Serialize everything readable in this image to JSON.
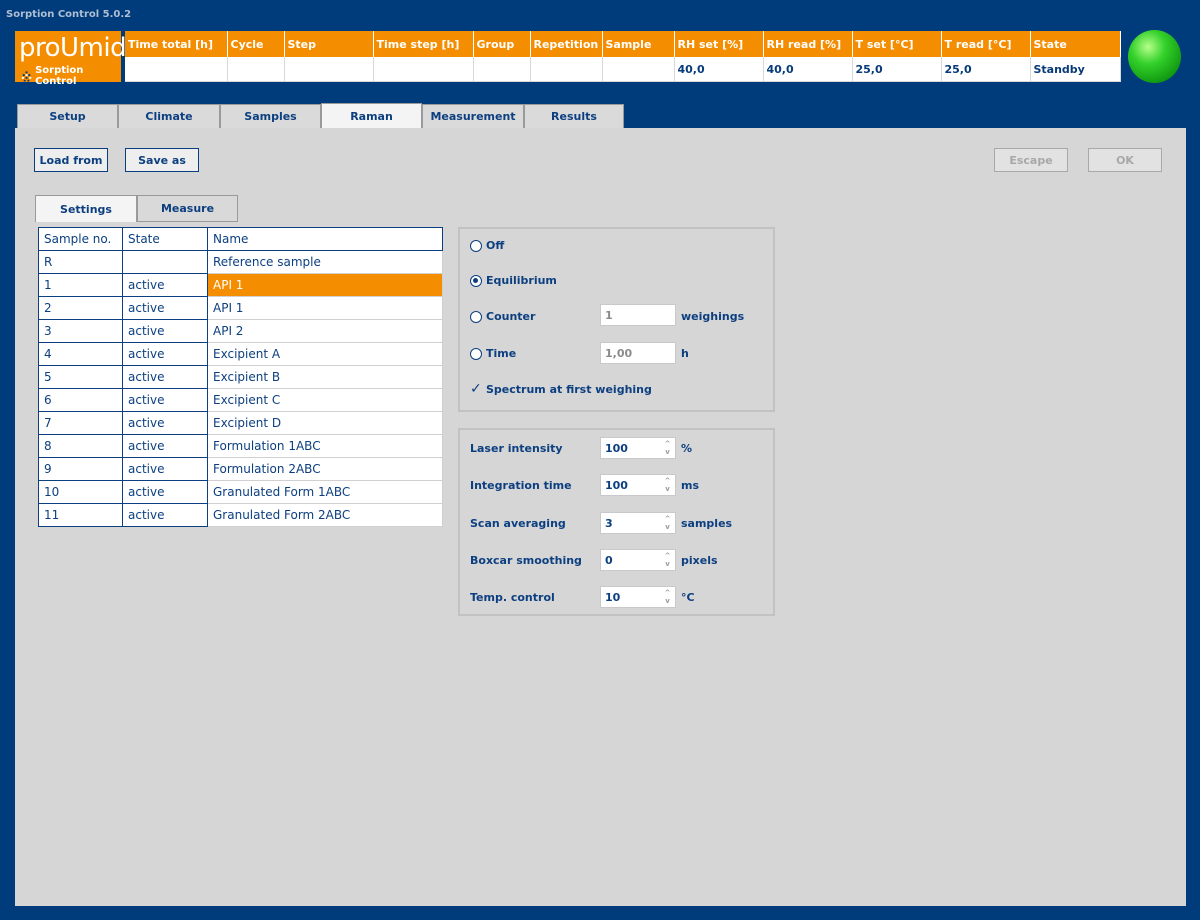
{
  "app": {
    "title": "Sorption Control 5.0.2"
  },
  "logo": {
    "brand": "proUmid",
    "subtitle": "Sorption Control"
  },
  "status": {
    "columns": [
      "Time total [h]",
      "Cycle",
      "Step",
      "Time step [h]",
      "Group",
      "Repetition",
      "Sample",
      "RH set [%]",
      "RH read [%]",
      "T set [°C]",
      "T read [°C]",
      "State"
    ],
    "values": [
      "",
      "",
      "",
      "",
      "",
      "",
      "",
      "40,0",
      "40,0",
      "25,0",
      "25,0",
      "Standby"
    ],
    "led_color": "#22c11e"
  },
  "tabs": [
    {
      "label": "Setup"
    },
    {
      "label": "Climate"
    },
    {
      "label": "Samples"
    },
    {
      "label": "Raman",
      "active": true
    },
    {
      "label": "Measurement"
    },
    {
      "label": "Results"
    }
  ],
  "toolbar": {
    "load_label": "Load from",
    "save_label": "Save as",
    "escape_label": "Escape",
    "ok_label": "OK"
  },
  "subtabs": [
    {
      "label": "Settings",
      "active": true
    },
    {
      "label": "Measure"
    }
  ],
  "samples": {
    "headers": [
      "Sample no.",
      "State",
      "Name"
    ],
    "rows": [
      {
        "no": "R",
        "state": "",
        "name": "Reference sample"
      },
      {
        "no": "1",
        "state": "active",
        "name": "API 1",
        "selected": true
      },
      {
        "no": "2",
        "state": "active",
        "name": "API 1"
      },
      {
        "no": "3",
        "state": "active",
        "name": "API 2"
      },
      {
        "no": "4",
        "state": "active",
        "name": "Excipient A"
      },
      {
        "no": "5",
        "state": "active",
        "name": "Excipient B"
      },
      {
        "no": "6",
        "state": "active",
        "name": "Excipient C"
      },
      {
        "no": "7",
        "state": "active",
        "name": "Excipient D"
      },
      {
        "no": "8",
        "state": "active",
        "name": "Formulation 1ABC"
      },
      {
        "no": "9",
        "state": "active",
        "name": "Formulation 2ABC"
      },
      {
        "no": "10",
        "state": "active",
        "name": "Granulated Form 1ABC"
      },
      {
        "no": "11",
        "state": "active",
        "name": "Granulated Form 2ABC"
      }
    ]
  },
  "trigger": {
    "off_label": "Off",
    "equilibrium_label": "Equilibrium",
    "counter_label": "Counter",
    "counter_value": "1",
    "counter_unit": "weighings",
    "time_label": "Time",
    "time_value": "1,00",
    "time_unit": "h",
    "spectrum_label": "Spectrum at first weighing",
    "selected": "Equilibrium",
    "spectrum_checked": true
  },
  "laser": {
    "intensity_label": "Laser intensity",
    "intensity_value": "100",
    "intensity_unit": "%",
    "integration_label": "Integration time",
    "integration_value": "100",
    "integration_unit": "ms",
    "scan_label": "Scan averaging",
    "scan_value": "3",
    "scan_unit": "samples",
    "boxcar_label": "Boxcar smoothing",
    "boxcar_value": "0",
    "boxcar_unit": "pixels",
    "temp_label": "Temp. control",
    "temp_value": "10",
    "temp_unit": "°C"
  }
}
